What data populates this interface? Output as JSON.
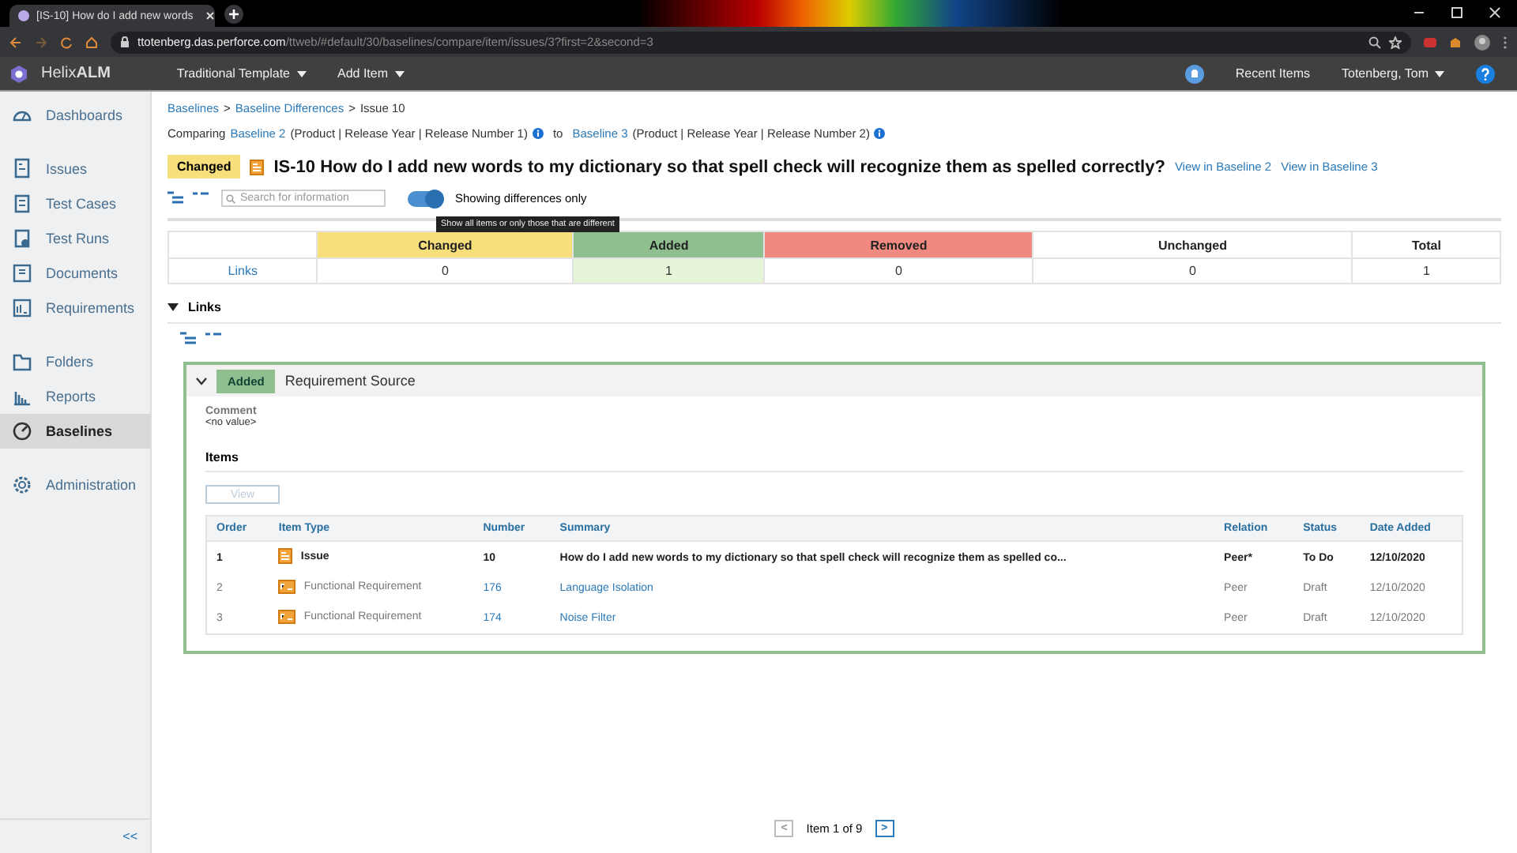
{
  "browser": {
    "tab_title": "[IS-10] How do I add new words",
    "url_host": "ttotenberg.das.perforce.com",
    "url_path": "/ttweb/#default/30/baselines/compare/item/issues/3?first=2&second=3"
  },
  "header": {
    "logo_light": "Helix",
    "logo_bold": "ALM",
    "menus": [
      "Traditional Template",
      "Add Item"
    ],
    "recent_items": "Recent Items",
    "user": "Totenberg, Tom"
  },
  "sidebar": {
    "groups": [
      [
        {
          "label": "Dashboards",
          "kind": "dashboard",
          "selected": false
        }
      ],
      [
        {
          "label": "Issues",
          "kind": "issues",
          "selected": false
        },
        {
          "label": "Test Cases",
          "kind": "clipboard",
          "selected": false
        },
        {
          "label": "Test Runs",
          "kind": "testrun",
          "selected": false
        },
        {
          "label": "Documents",
          "kind": "document",
          "selected": false
        },
        {
          "label": "Requirements",
          "kind": "requirement",
          "selected": false
        }
      ],
      [
        {
          "label": "Folders",
          "kind": "folder",
          "selected": false
        },
        {
          "label": "Reports",
          "kind": "chart",
          "selected": false
        },
        {
          "label": "Baselines",
          "kind": "baseline",
          "selected": true
        }
      ],
      [
        {
          "label": "Administration",
          "kind": "gear",
          "selected": false
        }
      ]
    ],
    "collapse": "<<"
  },
  "breadcrumb": [
    {
      "text": "Baselines",
      "link": true
    },
    {
      "text": ">",
      "link": false
    },
    {
      "text": "Baseline Differences",
      "link": true
    },
    {
      "text": ">",
      "link": false
    },
    {
      "text": "Issue 10",
      "link": false
    }
  ],
  "comparing": {
    "label": "Comparing",
    "left_link": "Baseline 2",
    "left_path": "(Product | Release Year | Release Number 1)",
    "joiner": "to",
    "right_link": "Baseline 3",
    "right_path": "(Product | Release Year | Release Number 2)"
  },
  "item": {
    "status": "Changed",
    "title": "IS-10 How do I add new words to my dictionary so that spell check will recognize them as spelled correctly?",
    "links": [
      "View in Baseline 2",
      "View in Baseline 3"
    ]
  },
  "toolbar": {
    "search_placeholder": "Search for information",
    "differences_only": true,
    "toggle_label": "Showing differences only",
    "tooltip": "Show all items or only those that are different"
  },
  "summary": {
    "columns": [
      {
        "label": "Changed",
        "color": "#f7df7c"
      },
      {
        "label": "Added",
        "color": "#8fbf8f"
      },
      {
        "label": "Removed",
        "color": "#f08a80"
      },
      {
        "label": "Unchanged",
        "color": "#ffffff"
      },
      {
        "label": "Total",
        "color": "#ffffff"
      }
    ],
    "rows": [
      {
        "label": "Links",
        "values": [
          {
            "text": "0",
            "highlighted": false
          },
          {
            "text": "1",
            "highlighted": true
          },
          {
            "text": "0",
            "highlighted": false
          },
          {
            "text": "0",
            "highlighted": false
          },
          {
            "text": "1",
            "highlighted": false
          }
        ]
      }
    ]
  },
  "section": {
    "title": "Links",
    "expanded": true
  },
  "card": {
    "expanded": true,
    "badge": "Added",
    "title": "Requirement Source",
    "comment_label": "Comment",
    "comment_value": "<no value>",
    "items_heading": "Items",
    "view_button": "View",
    "view_disabled": true,
    "columns": [
      "Order",
      "Item Type",
      "Number",
      "Summary",
      "Relation",
      "Status",
      "Date Added"
    ],
    "rows": [
      {
        "order": "1",
        "kind": "issue",
        "type": "Issue",
        "number": "10",
        "summary": "How do I add new words to my dictionary so that spell check will recognize them as spelled co...",
        "relation": "Peer*",
        "status": "To Do",
        "date": "12/10/2020",
        "current": true
      },
      {
        "order": "2",
        "kind": "requirement",
        "type": "Functional Requirement",
        "number": "176",
        "summary": "Language Isolation",
        "relation": "Peer",
        "status": "Draft",
        "date": "12/10/2020",
        "current": false
      },
      {
        "order": "3",
        "kind": "requirement",
        "type": "Functional Requirement",
        "number": "174",
        "summary": "Noise Filter",
        "relation": "Peer",
        "status": "Draft",
        "date": "12/10/2020",
        "current": false
      }
    ]
  },
  "pager": {
    "prev": "<",
    "label": "Item 1 of 9",
    "next": ">"
  }
}
